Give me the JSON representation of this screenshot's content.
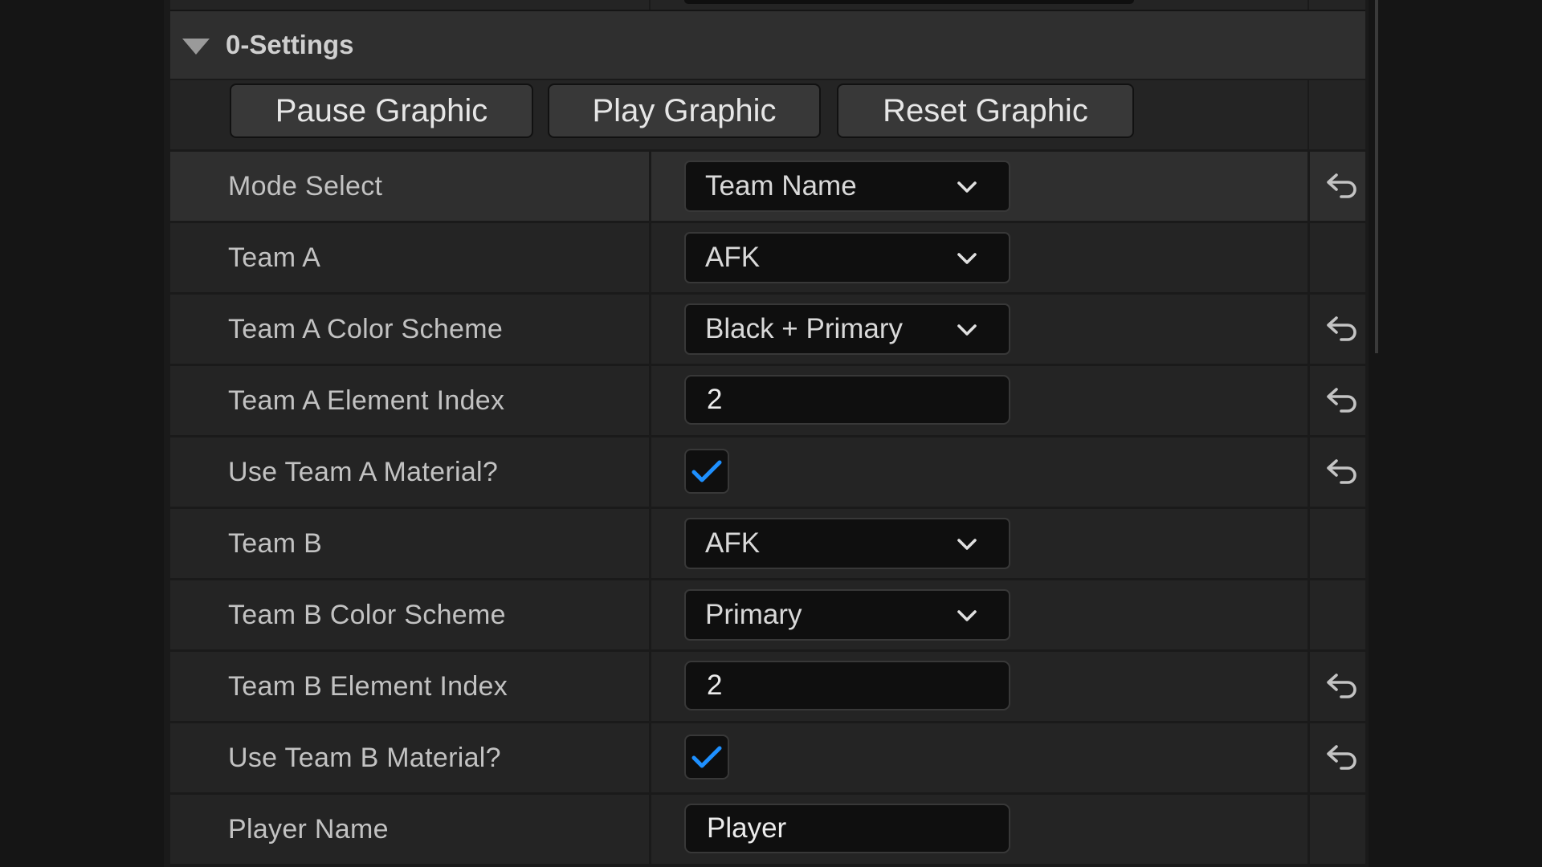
{
  "category": {
    "title": "0-Settings"
  },
  "buttons": {
    "pause": "Pause Graphic",
    "play": "Play Graphic",
    "reset": "Reset Graphic"
  },
  "properties": [
    {
      "label": "Mode Select",
      "type": "combo",
      "value": "Team Name",
      "resettable": true
    },
    {
      "label": "Team A",
      "type": "combo",
      "value": "AFK",
      "resettable": false
    },
    {
      "label": "Team A Color Scheme",
      "type": "combo",
      "value": "Black + Primary",
      "resettable": true
    },
    {
      "label": "Team A Element Index",
      "type": "number",
      "value": "2",
      "resettable": true
    },
    {
      "label": "Use Team A Material?",
      "type": "checkbox",
      "checked": true,
      "resettable": true
    },
    {
      "label": "Team B",
      "type": "combo",
      "value": "AFK",
      "resettable": false
    },
    {
      "label": "Team B Color Scheme",
      "type": "combo",
      "value": "Primary",
      "resettable": false
    },
    {
      "label": "Team B Element Index",
      "type": "number",
      "value": "2",
      "resettable": true
    },
    {
      "label": "Use Team B Material?",
      "type": "checkbox",
      "checked": true,
      "resettable": true
    },
    {
      "label": "Player Name",
      "type": "text",
      "value": "Player",
      "resettable": false
    }
  ],
  "icons": {
    "expand": "triangle-down-icon",
    "dropdown": "chevron-down-icon",
    "reset": "reset-arrow-icon",
    "check": "checkmark-icon"
  },
  "colors": {
    "check": "#1e90ff",
    "panel": "#242424",
    "highlight_row": "#2f2f2f",
    "field": "#0f0f0f"
  }
}
